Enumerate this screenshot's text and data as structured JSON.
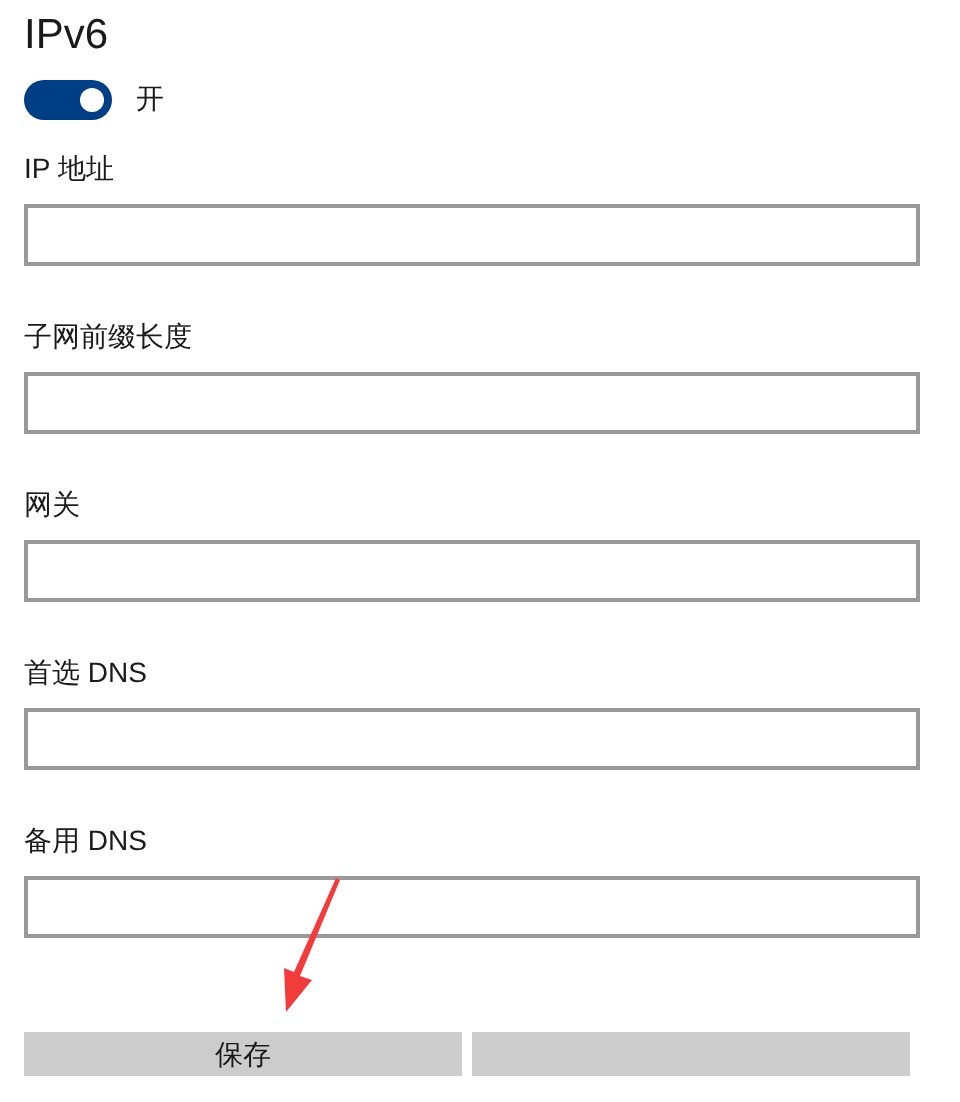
{
  "section": {
    "title": "IPv6"
  },
  "toggle": {
    "on": true,
    "label": "开"
  },
  "fields": [
    {
      "label": "IP 地址"
    },
    {
      "label": "子网前缀长度"
    },
    {
      "label": "网关"
    },
    {
      "label": "首选 DNS"
    },
    {
      "label": "备用 DNS"
    }
  ],
  "buttons": [
    {
      "kind": "labeled",
      "label": "保存"
    },
    {
      "kind": "covered"
    }
  ]
}
